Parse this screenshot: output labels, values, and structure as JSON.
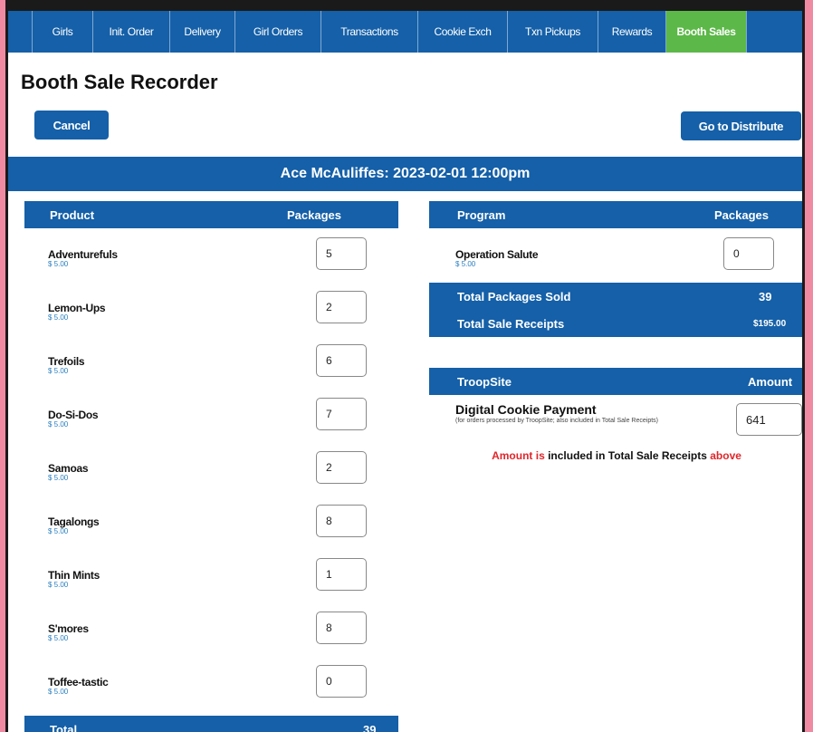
{
  "nav": {
    "tabs": [
      {
        "label": "Girls"
      },
      {
        "label": "Init. Order"
      },
      {
        "label": "Delivery"
      },
      {
        "label": "Girl Orders"
      },
      {
        "label": "Transactions"
      },
      {
        "label": "Cookie Exch"
      },
      {
        "label": "Txn Pickups"
      },
      {
        "label": "Rewards"
      },
      {
        "label": "Booth Sales"
      }
    ],
    "active_color": "#5cb848",
    "bar_color": "#1560a8"
  },
  "page": {
    "title": "Booth Sale Recorder",
    "cancel_label": "Cancel",
    "distribute_label": "Go to Distribute",
    "banner": "Ace McAuliffes: 2023-02-01 12:00pm"
  },
  "products": {
    "header_product": "Product",
    "header_packages": "Packages",
    "items": [
      {
        "name": "Adventurefuls",
        "price": "$ 5.00",
        "qty": "5"
      },
      {
        "name": "Lemon-Ups",
        "price": "$ 5.00",
        "qty": "2"
      },
      {
        "name": "Trefoils",
        "price": "$ 5.00",
        "qty": "6"
      },
      {
        "name": "Do-Si-Dos",
        "price": "$ 5.00",
        "qty": "7"
      },
      {
        "name": "Samoas",
        "price": "$ 5.00",
        "qty": "2"
      },
      {
        "name": "Tagalongs",
        "price": "$ 5.00",
        "qty": "8"
      },
      {
        "name": "Thin Mints",
        "price": "$ 5.00",
        "qty": "1"
      },
      {
        "name": "S'mores",
        "price": "$ 5.00",
        "qty": "8"
      },
      {
        "name": "Toffee-tastic",
        "price": "$ 5.00",
        "qty": "0"
      }
    ],
    "total_label": "Total",
    "total_value": "39"
  },
  "program": {
    "header_program": "Program",
    "header_packages": "Packages",
    "item_name": "Operation Salute",
    "item_price": "$ 5.00",
    "item_qty": "0",
    "total_packages_label": "Total Packages Sold",
    "total_packages_value": "39",
    "total_receipts_label": "Total Sale Receipts",
    "total_receipts_value": "$195.00"
  },
  "troopsite": {
    "header_label": "TroopSite",
    "header_amount": "Amount",
    "item_name": "Digital Cookie Payment",
    "item_note": "(for orders processed by TroopSite; also included in Total Sale Receipts)",
    "amount": "641",
    "note_part1": "Amount is",
    "note_part2": " included in Total Sale Receipts ",
    "note_part3": "above"
  }
}
